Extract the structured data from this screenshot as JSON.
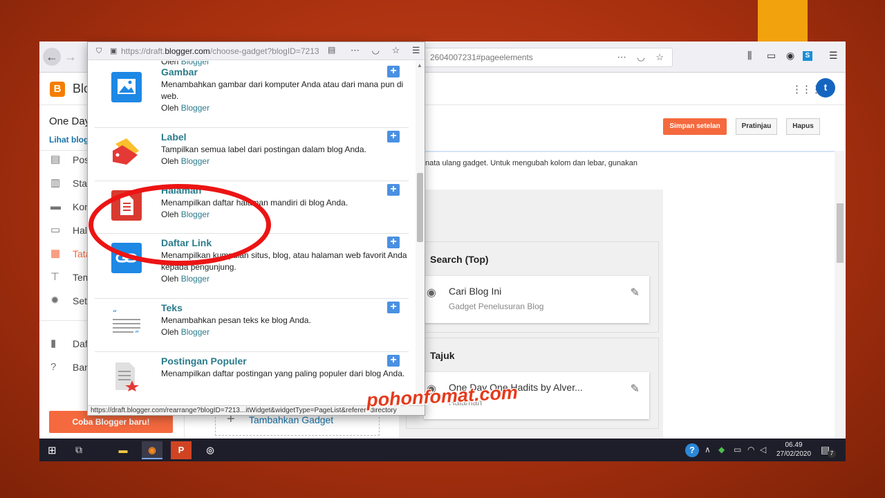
{
  "browser": {
    "background_url": "2604007231#pageelements",
    "popup_url_prefix": "https://draft.",
    "popup_url_host": "blogger.com",
    "popup_url_rest": "/choose-gadget?blogID=7213",
    "status_bar": "https://draft.blogger.com/rearrange?blogID=7213...itWidget&widgetType=PageList&referer=directory"
  },
  "header": {
    "app_title": "Blo",
    "avatar_letter": "t"
  },
  "sidebar": {
    "blog_name": "One Day",
    "view_blog_link": "Lihat blog",
    "items": [
      {
        "label": "Pos",
        "icon": "posts-icon"
      },
      {
        "label": "Stat",
        "icon": "stats-icon"
      },
      {
        "label": "Kon",
        "icon": "comments-icon"
      },
      {
        "label": "Hal",
        "icon": "pages-icon"
      },
      {
        "label": "Tata",
        "icon": "layout-icon",
        "active": true
      },
      {
        "label": "Tem",
        "icon": "theme-icon"
      },
      {
        "label": "Sete",
        "icon": "settings-icon"
      },
      {
        "label": "Daft",
        "icon": "reading-list-icon"
      },
      {
        "label": "Ban",
        "icon": "help-icon"
      }
    ],
    "try_new_button": "Coba Blogger baru!"
  },
  "toolbar": {
    "save_label": "Simpan setelan",
    "preview_label": "Pratinjau",
    "delete_label": "Hapus"
  },
  "main": {
    "instruction_text": "nata ulang gadget. Untuk mengubah kolom dan lebar, gunakan",
    "sections": [
      {
        "title": "Search (Top)",
        "gadget_title": "Cari Blog Ini",
        "gadget_subtitle": "Gadget Penelusuran Blog"
      },
      {
        "title": "Tajuk",
        "gadget_title": "One Day One Hadits by Alver...",
        "gadget_subtitle": "Halaman"
      }
    ],
    "add_gadget_label": "Tambahkan Gadget"
  },
  "popup": {
    "by_prefix": "Oleh",
    "by_link": "Blogger",
    "gadgets": [
      {
        "name": "Gambar",
        "desc": "Menambahkan gambar dari komputer Anda atau dari mana pun di web."
      },
      {
        "name": "Label",
        "desc": "Tampilkan semua label dari postingan dalam blog Anda."
      },
      {
        "name": "Halaman",
        "desc": "Menampilkan daftar halaman mandiri di blog Anda."
      },
      {
        "name": "Daftar Link",
        "desc": "Menampilkan kumpulan situs, blog, atau halaman web favorit Anda kepada pengunjung."
      },
      {
        "name": "Teks",
        "desc": "Menambahkan pesan teks ke blog Anda."
      },
      {
        "name": "Postingan Populer",
        "desc": "Menampilkan daftar postingan yang paling populer dari blog Anda."
      }
    ]
  },
  "taskbar": {
    "time": "06.49",
    "date": "27/02/2020",
    "notification_count": "7"
  },
  "watermark": "pohonfomat.com",
  "colors": {
    "accent_orange": "#f5693e",
    "gadget_teal": "#2a7c8c",
    "add_blue": "#4a90e2",
    "highlight_red": "#ec1414"
  }
}
